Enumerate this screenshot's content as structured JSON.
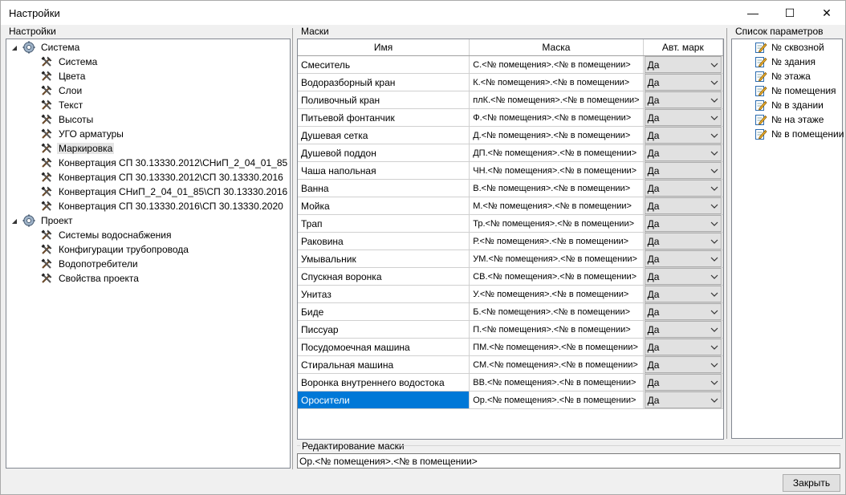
{
  "window": {
    "title": "Настройки",
    "minimize": "—",
    "maximize": "☐",
    "close": "✕"
  },
  "settings_panel": {
    "label": "Настройки",
    "tree": [
      {
        "label": "Система",
        "level": 0,
        "expander": "◢",
        "icon": "gear-icon"
      },
      {
        "label": "Система",
        "level": 1,
        "icon": "tools-icon"
      },
      {
        "label": "Цвета",
        "level": 1,
        "icon": "tools-icon"
      },
      {
        "label": "Слои",
        "level": 1,
        "icon": "tools-icon"
      },
      {
        "label": "Текст",
        "level": 1,
        "icon": "tools-icon"
      },
      {
        "label": "Высоты",
        "level": 1,
        "icon": "tools-icon"
      },
      {
        "label": "УГО арматуры",
        "level": 1,
        "icon": "tools-icon"
      },
      {
        "label": "Маркировка",
        "level": 1,
        "icon": "tools-icon",
        "selected": true
      },
      {
        "label": "Конвертация СП 30.13330.2012\\СНиП_2_04_01_85",
        "level": 1,
        "icon": "tools-icon"
      },
      {
        "label": "Конвертация СП 30.13330.2012\\СП 30.13330.2016",
        "level": 1,
        "icon": "tools-icon"
      },
      {
        "label": "Конвертация СНиП_2_04_01_85\\СП 30.13330.2016",
        "level": 1,
        "icon": "tools-icon"
      },
      {
        "label": "Конвертация СП 30.13330.2016\\СП 30.13330.2020",
        "level": 1,
        "icon": "tools-icon"
      },
      {
        "label": "Проект",
        "level": 0,
        "expander": "◢",
        "icon": "gear-icon"
      },
      {
        "label": "Системы водоснабжения",
        "level": 1,
        "icon": "tools-icon"
      },
      {
        "label": "Конфигурации трубопровода",
        "level": 1,
        "icon": "tools-icon"
      },
      {
        "label": "Водопотребители",
        "level": 1,
        "icon": "tools-icon"
      },
      {
        "label": "Свойства проекта",
        "level": 1,
        "icon": "tools-icon"
      }
    ]
  },
  "masks_panel": {
    "label": "Маски",
    "columns": [
      "Имя",
      "Маска",
      "Авт. марк"
    ],
    "rows": [
      {
        "name": "Смеситель",
        "mask": "С.<№ помещения>.<№ в помещении>",
        "auto": "Да"
      },
      {
        "name": "Водоразборный кран",
        "mask": "К.<№ помещения>.<№ в помещении>",
        "auto": "Да"
      },
      {
        "name": "Поливочный кран",
        "mask": "плК.<№ помещения>.<№ в помещении>",
        "auto": "Да"
      },
      {
        "name": "Питьевой фонтанчик",
        "mask": "Ф.<№ помещения>.<№ в помещении>",
        "auto": "Да"
      },
      {
        "name": "Душевая сетка",
        "mask": "Д.<№ помещения>.<№ в помещении>",
        "auto": "Да"
      },
      {
        "name": "Душевой поддон",
        "mask": "ДП.<№ помещения>.<№ в помещении>",
        "auto": "Да"
      },
      {
        "name": "Чаша напольная",
        "mask": "ЧН.<№ помещения>.<№ в помещении>",
        "auto": "Да"
      },
      {
        "name": "Ванна",
        "mask": "В.<№ помещения>.<№ в помещении>",
        "auto": "Да"
      },
      {
        "name": "Мойка",
        "mask": "М.<№ помещения>.<№ в помещении>",
        "auto": "Да"
      },
      {
        "name": "Трап",
        "mask": "Тр.<№ помещения>.<№ в помещении>",
        "auto": "Да"
      },
      {
        "name": "Раковина",
        "mask": "Р.<№ помещения>.<№ в помещении>",
        "auto": "Да"
      },
      {
        "name": "Умывальник",
        "mask": "УМ.<№ помещения>.<№ в помещении>",
        "auto": "Да"
      },
      {
        "name": "Спускная воронка",
        "mask": "СВ.<№ помещения>.<№ в помещении>",
        "auto": "Да"
      },
      {
        "name": "Унитаз",
        "mask": "У.<№ помещения>.<№ в помещении>",
        "auto": "Да"
      },
      {
        "name": "Биде",
        "mask": "Б.<№ помещения>.<№ в помещении>",
        "auto": "Да"
      },
      {
        "name": "Писсуар",
        "mask": "П.<№ помещения>.<№ в помещении>",
        "auto": "Да"
      },
      {
        "name": "Посудомоечная машина",
        "mask": "ПМ.<№ помещения>.<№ в помещении>",
        "auto": "Да"
      },
      {
        "name": "Стиральная машина",
        "mask": "СМ.<№ помещения>.<№ в помещении>",
        "auto": "Да"
      },
      {
        "name": "Воронка внутреннего водостока",
        "mask": "ВВ.<№ помещения>.<№ в помещении>",
        "auto": "Да"
      },
      {
        "name": "Оросители",
        "mask": "Ор.<№ помещения>.<№ в помещении>",
        "auto": "Да",
        "selected": true
      }
    ],
    "selection_color": "#0078d7"
  },
  "params_panel": {
    "label": "Список параметров",
    "items": [
      "№ сквозной",
      "№ здания",
      "№ этажа",
      "№ помещения",
      "№ в здании",
      "№ на этаже",
      "№ в помещении"
    ]
  },
  "edit_mask": {
    "label": "Редактирование маски",
    "value": "Ор.<№ помещения>.<№ в помещении>"
  },
  "close_button": {
    "label": "Закрыть"
  }
}
